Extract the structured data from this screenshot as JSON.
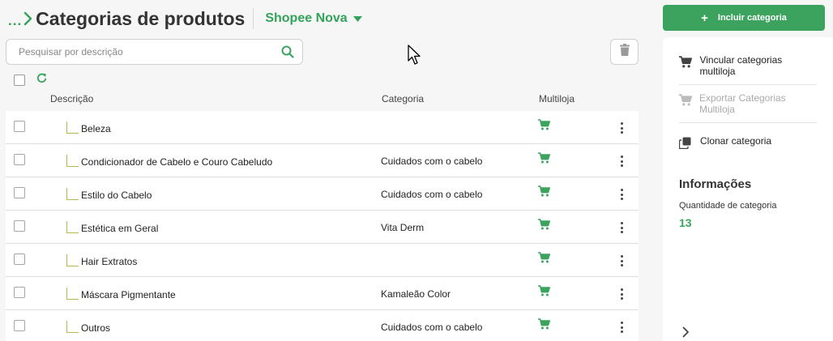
{
  "header": {
    "breadcrumb_dots": "...",
    "title": "Categorias de produtos",
    "store": "Shopee Nova",
    "add_button": "Incluir categoria"
  },
  "search": {
    "placeholder": "Pesquisar por descrição"
  },
  "table": {
    "columns": {
      "description": "Descrição",
      "category": "Categoria",
      "multistore": "Multiloja"
    },
    "rows": [
      {
        "description": "Beleza",
        "category": ""
      },
      {
        "description": "Condicionador de Cabelo e Couro Cabeludo",
        "category": "Cuidados com o cabelo"
      },
      {
        "description": "Estilo do Cabelo",
        "category": "Cuidados com o cabelo"
      },
      {
        "description": "Estética em Geral",
        "category": "Vita Derm"
      },
      {
        "description": "Hair Extratos",
        "category": ""
      },
      {
        "description": "Máscara Pigmentante",
        "category": "Kamaleão Color"
      },
      {
        "description": "Outros",
        "category": "Cuidados com o cabelo"
      }
    ]
  },
  "panel": {
    "link_multistore": "Vincular categorias multiloja",
    "export_multistore": "Exportar Categorias Multiloja",
    "clone": "Clonar categoria",
    "info_title": "Informações",
    "count_label": "Quantidade de categoria",
    "count_value": "13"
  },
  "colors": {
    "accent": "#3ca35f",
    "tree_line": "#b5b94a"
  },
  "icons": {
    "breadcrumb": "chevron-right-icon",
    "store": "caret-down-icon",
    "search": "search-icon",
    "trash": "trash-icon",
    "refresh": "refresh-icon",
    "multistore": "cart-icon",
    "row_menu": "more-vertical-icon",
    "clone": "clone-icon",
    "panel_expand": "chevron-right-icon"
  }
}
